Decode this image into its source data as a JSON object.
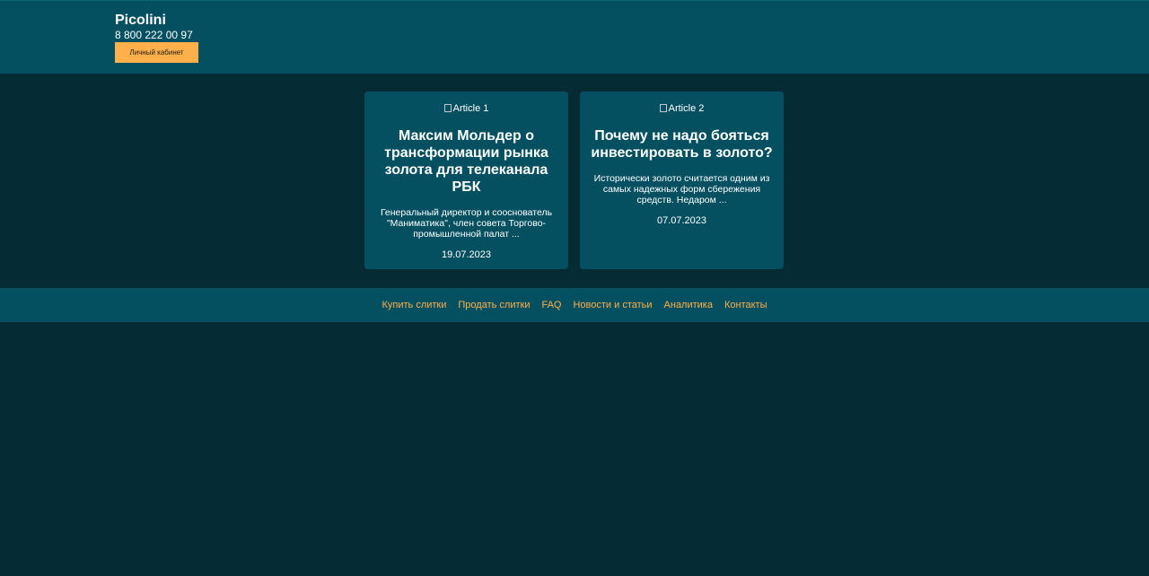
{
  "header": {
    "brand": "Picolini",
    "phone": "8 800 222 00 97",
    "cabinet_button": "Личный кабинет"
  },
  "articles": [
    {
      "image_alt": "Article 1",
      "title": "Максим Мольдер о трансформации рынка золота для телеканала РБК",
      "excerpt": "Генеральный директор и сооснователь \"Маниматика\", член совета Торгово-промышленной палат ...",
      "date": "19.07.2023"
    },
    {
      "image_alt": "Article 2",
      "title": "Почему не надо бояться инвестировать в золото?",
      "excerpt": "Исторически золото считается одним из самых надежных форм сбережения средств. Недаром ...",
      "date": "07.07.2023"
    }
  ],
  "footer": {
    "links": [
      "Купить слитки",
      "Продать слитки",
      "FAQ",
      "Новости и статьи",
      "Аналитика",
      "Контакты"
    ]
  },
  "colors": {
    "background": "#052b35",
    "panel": "#045060",
    "accent": "#ffb04a"
  }
}
